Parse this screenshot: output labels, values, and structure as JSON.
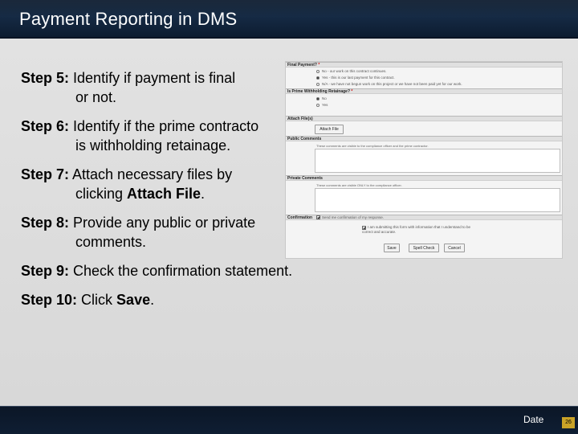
{
  "slide": {
    "title": "Payment Reporting in DMS",
    "steps": [
      {
        "label": "Step 5:",
        "text": "Identify if payment is final",
        "cont": "or not."
      },
      {
        "label": "Step 6:",
        "text": "Identify if the prime contracto",
        "cont": "is withholding retainage."
      },
      {
        "label": "Step 7:",
        "text": "Attach necessary files by",
        "cont_pre": "clicking ",
        "cont_bold": "Attach File",
        "cont_post": "."
      },
      {
        "label": "Step 8:",
        "text": "Provide any public or private",
        "cont": "comments."
      },
      {
        "label": "Step 9:",
        "text": "Check the confirmation statement."
      },
      {
        "label": "Step 10:",
        "text_pre": "Click ",
        "text_bold": "Save",
        "text_post": "."
      }
    ]
  },
  "form": {
    "final_payment": {
      "label": "Final Payment?",
      "required_mark": "*",
      "options": [
        "No - our work on this contract continues.",
        "Yes - this is our last payment for this contract.",
        "N/A - we have not begun work on this project or we have not been paid yet for our work."
      ],
      "selected_index": 1
    },
    "retainage": {
      "label": "Is Prime Withholding Retainage?",
      "required_mark": "*",
      "options": [
        "No",
        "Yes"
      ],
      "selected_index": 0
    },
    "attach": {
      "label": "Attach File(s)",
      "button": "Attach File"
    },
    "public_comments": {
      "label": "Public Comments",
      "hint": "These comments are visible to the compliance officer and the prime contractor."
    },
    "private_comments": {
      "label": "Private Comments",
      "hint": "These comments are visible ONLY to the compliance officer."
    },
    "confirmation": {
      "label": "Confirmation",
      "send_confirmation": "Send me confirmation of my response.",
      "statement": "I am submitting this form with information that I understand to be correct and accurate.",
      "statement_line1": "I am submitting this form with information that I understand to be",
      "statement_line2": "correct and accurate.",
      "send_checked": true,
      "statement_checked": true
    },
    "buttons": {
      "save": "Save",
      "spell_check": "Spell Check",
      "cancel": "Cancel"
    }
  },
  "footer": {
    "date": "Date",
    "page_number": "26"
  },
  "colors": {
    "title_bar": "#0c1b2e",
    "content_bg": "#dcdcdc",
    "footer_bg": "#0f1e33",
    "page_badge": "#c9a227",
    "required": "#cc0000"
  }
}
